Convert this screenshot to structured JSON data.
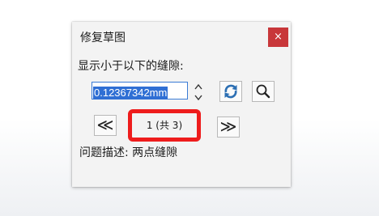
{
  "dialog": {
    "title": "修复草图",
    "close_label": "×"
  },
  "gap": {
    "label": "显示小于以下的缝隙:",
    "value": "0.12367342mm"
  },
  "navigation": {
    "prev_label": "≪",
    "next_label": "≫",
    "page_text": "1 (共 3)"
  },
  "description": "问题描述: 两点缝隙",
  "colors": {
    "close_button": "#c8373a",
    "highlight_border": "#ee1c1c",
    "selection": "#2f6fd4",
    "refresh_icon": "#2c6fb3"
  },
  "icons": {
    "refresh": "refresh-icon",
    "search": "search-icon",
    "spinner": "spinner-icon"
  }
}
